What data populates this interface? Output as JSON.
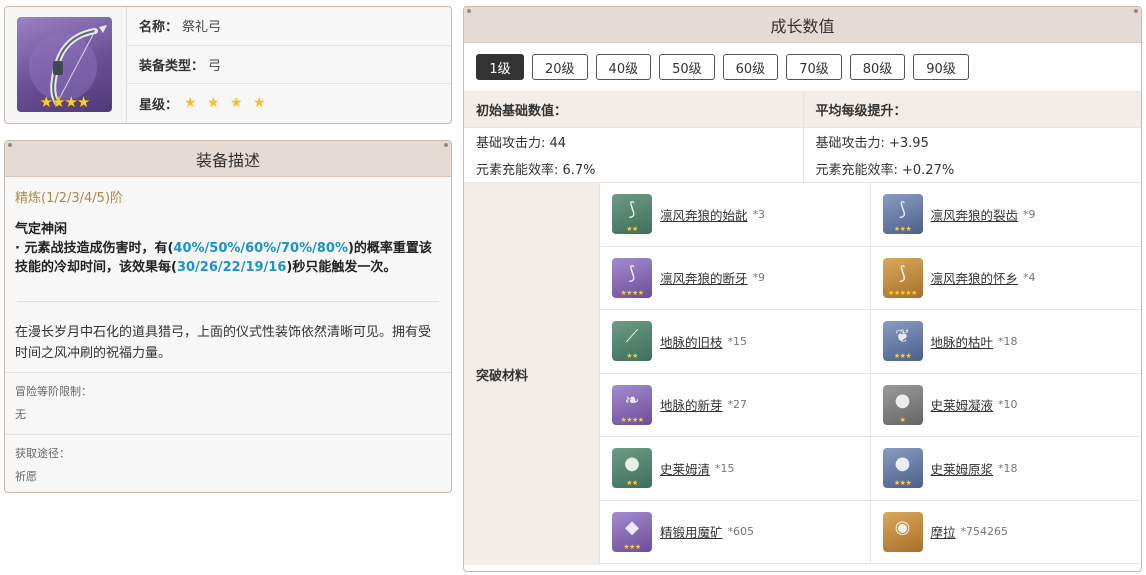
{
  "weapon": {
    "name_key": "名称：",
    "name": "祭礼弓",
    "type_key": "装备类型：",
    "type": "弓",
    "rarity_key": "星级：",
    "rarity_stars": "★ ★ ★ ★",
    "thumb_stars": "★★★★"
  },
  "description": {
    "title": "装备描述",
    "refine": "精炼(1/2/3/4/5)阶",
    "passive_name": "气定神闲",
    "passive_p1": "· 元素战技造成伤害时，有(",
    "passive_v1": "40%/50%/60%/70%/80%",
    "passive_p2": ")的概率重置该技能的冷却时间，该效果每(",
    "passive_v2": "30/26/22/19/16",
    "passive_p3": ")秒只能触发一次。",
    "lore": "在漫长岁月中石化的道具猎弓，上面的仪式性装饰依然清晰可见。拥有受时间之风冲刷的祝福力量。",
    "level_limit_label": "冒险等阶限制：",
    "level_limit_value": "无",
    "source_label": "获取途径：",
    "source_value": "祈愿"
  },
  "growth": {
    "title": "成长数值",
    "levels": [
      "1级",
      "20级",
      "40级",
      "50级",
      "60级",
      "70级",
      "80级",
      "90级"
    ],
    "active_level": "1级",
    "base_head": "初始基础数值：",
    "base_stats": [
      "基础攻击力: 44",
      "元素充能效率: 6.7%"
    ],
    "per_level_head": "平均每级提升：",
    "per_level_stats": [
      "基础攻击力: +3.95",
      "元素充能效率: +0.27%"
    ],
    "materials_label": "突破材料",
    "materials": [
      {
        "name": "凛风奔狼的始龀",
        "count": "*3",
        "icon": "fang-icon",
        "color": "green",
        "stars": "★★"
      },
      {
        "name": "凛风奔狼的裂齿",
        "count": "*9",
        "icon": "fang-icon",
        "color": "blue",
        "stars": "★★★"
      },
      {
        "name": "凛风奔狼的断牙",
        "count": "*9",
        "icon": "fang-icon",
        "color": "purple",
        "stars": "★★★★"
      },
      {
        "name": "凛风奔狼的怀乡",
        "count": "*4",
        "icon": "fang-icon",
        "color": "gold",
        "stars": "★★★★★"
      },
      {
        "name": "地脉的旧枝",
        "count": "*15",
        "icon": "branch-icon",
        "color": "green",
        "stars": "★★"
      },
      {
        "name": "地脉的枯叶",
        "count": "*18",
        "icon": "leaf-icon",
        "color": "blue",
        "stars": "★★★"
      },
      {
        "name": "地脉的新芽",
        "count": "*27",
        "icon": "sprout-icon",
        "color": "purple",
        "stars": "★★★★"
      },
      {
        "name": "史莱姆凝液",
        "count": "*10",
        "icon": "slime-icon",
        "color": "gray",
        "stars": "★"
      },
      {
        "name": "史莱姆清",
        "count": "*15",
        "icon": "slime-icon",
        "color": "green",
        "stars": "★★"
      },
      {
        "name": "史莱姆原浆",
        "count": "*18",
        "icon": "slime-icon",
        "color": "blue",
        "stars": "★★★"
      },
      {
        "name": "精锻用魔矿",
        "count": "*605",
        "icon": "ore-icon",
        "color": "purple",
        "stars": "★★★"
      },
      {
        "name": "摩拉",
        "count": "*754265",
        "icon": "coin-icon",
        "color": "gold",
        "stars": ""
      }
    ]
  }
}
